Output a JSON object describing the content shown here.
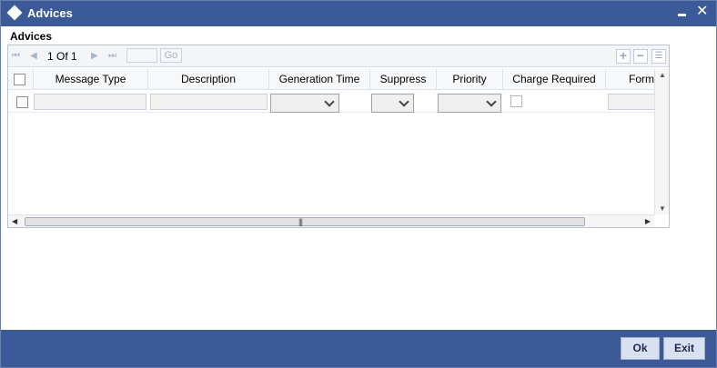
{
  "window": {
    "title": "Advices"
  },
  "section": {
    "title": "Advices"
  },
  "pager": {
    "first": "⏮",
    "prev": "◀",
    "info": "1 Of 1",
    "next": "▶",
    "last": "⏭",
    "go_label": "Go"
  },
  "toolbar": {
    "add": "+",
    "delete": "−",
    "list": "☰"
  },
  "columns": [
    "Message Type",
    "Description",
    "Generation Time",
    "Suppress",
    "Priority",
    "Charge Required",
    "Form"
  ],
  "footer": {
    "ok_label": "Ok",
    "exit_label": "Exit"
  },
  "colors": {
    "titlebar": "#3d5a98",
    "button_bg": "#d9e1f0"
  }
}
